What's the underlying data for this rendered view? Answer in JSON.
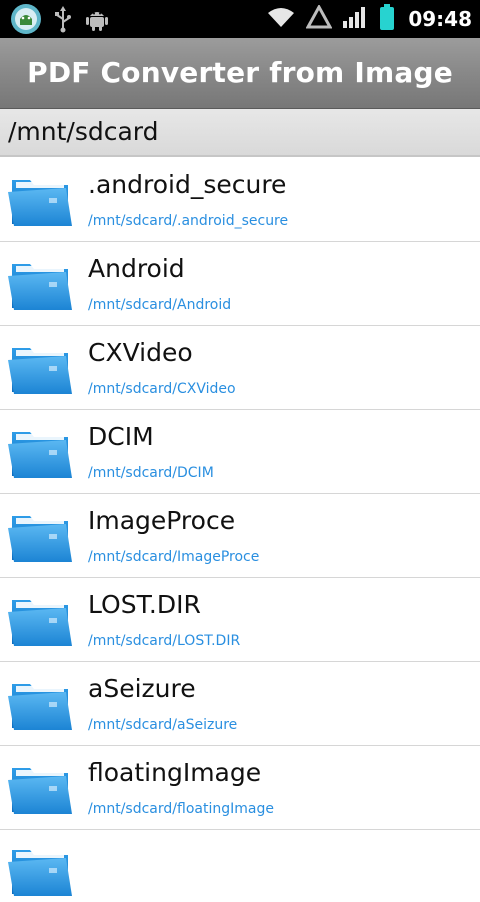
{
  "status_bar": {
    "left_icons": [
      "app-notification-icon",
      "usb-icon",
      "android-debug-icon"
    ],
    "right_icons": [
      "wifi-icon",
      "no-signal-triangle-icon",
      "signal-bars-icon",
      "battery-icon"
    ],
    "time": "09:48"
  },
  "app": {
    "title": "PDF Converter from Image"
  },
  "path_bar": {
    "current_path": "/mnt/sdcard"
  },
  "colors": {
    "status_bar_bg": "#000000",
    "title_bar_bg": "#8a8a8a",
    "path_bar_bg": "#e0e0e0",
    "subtitle_blue": "#2a8fe0",
    "folder_blue": "#1e88d6"
  },
  "folders": [
    {
      "name": ".android_secure",
      "path": "/mnt/sdcard/.android_secure",
      "icon": "folder-icon"
    },
    {
      "name": "Android",
      "path": "/mnt/sdcard/Android",
      "icon": "folder-icon"
    },
    {
      "name": "CXVideo",
      "path": "/mnt/sdcard/CXVideo",
      "icon": "folder-icon"
    },
    {
      "name": "DCIM",
      "path": "/mnt/sdcard/DCIM",
      "icon": "folder-icon"
    },
    {
      "name": "ImageProce",
      "path": "/mnt/sdcard/ImageProce",
      "icon": "folder-icon"
    },
    {
      "name": "LOST.DIR",
      "path": "/mnt/sdcard/LOST.DIR",
      "icon": "folder-icon"
    },
    {
      "name": "aSeizure",
      "path": "/mnt/sdcard/aSeizure",
      "icon": "folder-icon"
    },
    {
      "name": "floatingImage",
      "path": "/mnt/sdcard/floatingImage",
      "icon": "folder-icon"
    }
  ]
}
